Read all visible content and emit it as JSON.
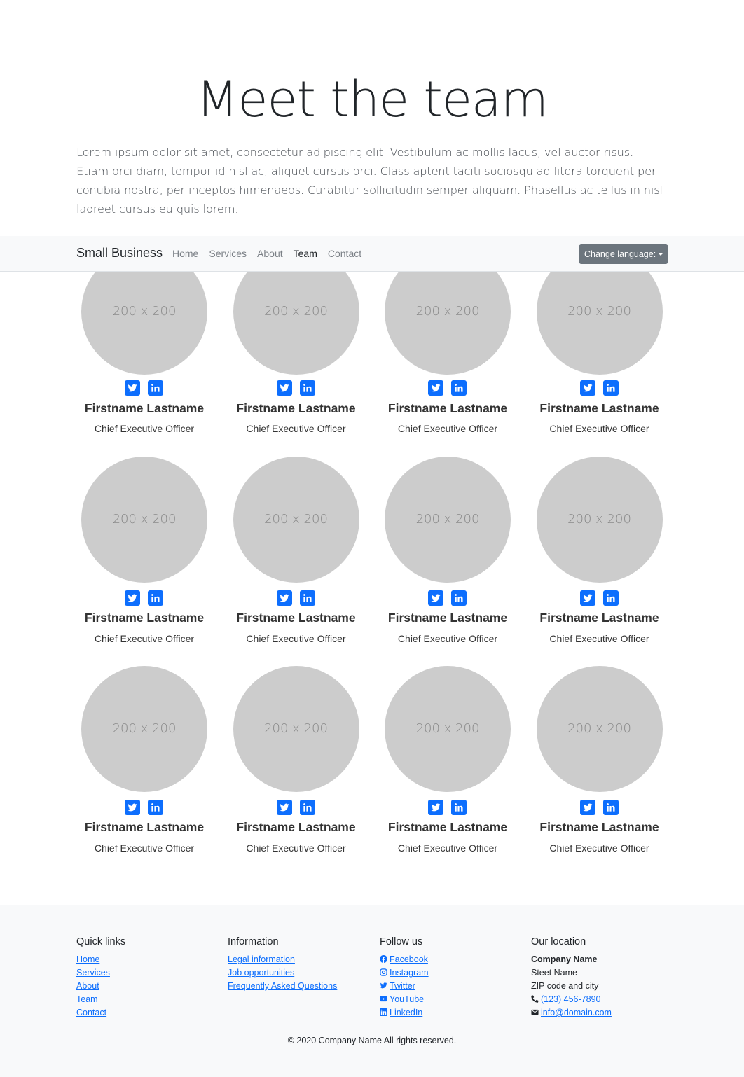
{
  "hero": {
    "title": "Meet the team",
    "intro": "Lorem ipsum dolor sit amet, consectetur adipiscing elit. Vestibulum ac mollis lacus, vel auctor risus. Etiam orci diam, tempor id nisl ac, aliquet cursus orci. Class aptent taciti sociosqu ad litora torquent per conubia nostra, per inceptos himenaeos. Curabitur sollicitudin semper aliquam. Phasellus ac tellus in nisl laoreet cursus eu quis lorem."
  },
  "navbar": {
    "brand": "Small Business",
    "links": [
      "Home",
      "Services",
      "About",
      "Team",
      "Contact"
    ],
    "active": "Team",
    "language_button": "Change language:"
  },
  "team": {
    "photo_placeholder": "200 x 200",
    "members": [
      {
        "name": "Firstname Lastname",
        "title": "Chief Executive Officer"
      },
      {
        "name": "Firstname Lastname",
        "title": "Chief Executive Officer"
      },
      {
        "name": "Firstname Lastname",
        "title": "Chief Executive Officer"
      },
      {
        "name": "Firstname Lastname",
        "title": "Chief Executive Officer"
      },
      {
        "name": "Firstname Lastname",
        "title": "Chief Executive Officer"
      },
      {
        "name": "Firstname Lastname",
        "title": "Chief Executive Officer"
      },
      {
        "name": "Firstname Lastname",
        "title": "Chief Executive Officer"
      },
      {
        "name": "Firstname Lastname",
        "title": "Chief Executive Officer"
      },
      {
        "name": "Firstname Lastname",
        "title": "Chief Executive Officer"
      },
      {
        "name": "Firstname Lastname",
        "title": "Chief Executive Officer"
      },
      {
        "name": "Firstname Lastname",
        "title": "Chief Executive Officer"
      },
      {
        "name": "Firstname Lastname",
        "title": "Chief Executive Officer"
      }
    ],
    "social_icons": [
      "twitter-icon",
      "linkedin-icon"
    ]
  },
  "footer": {
    "quick_links": {
      "heading": "Quick links",
      "items": [
        "Home",
        "Services",
        "About",
        "Team",
        "Contact"
      ]
    },
    "information": {
      "heading": "Information",
      "items": [
        "Legal information",
        "Job opportunities",
        "Frequently Asked Questions"
      ]
    },
    "follow_us": {
      "heading": "Follow us",
      "items": [
        {
          "label": "Facebook",
          "icon": "facebook-icon"
        },
        {
          "label": "Instagram",
          "icon": "instagram-icon"
        },
        {
          "label": "Twitter",
          "icon": "twitter-icon"
        },
        {
          "label": "YouTube",
          "icon": "youtube-icon"
        },
        {
          "label": "LinkedIn",
          "icon": "linkedin-icon"
        }
      ]
    },
    "location": {
      "heading": "Our location",
      "company": "Company Name",
      "street": "Steet Name",
      "zip_city": "ZIP code and city",
      "phone": "(123) 456-7890",
      "email": "info@domain.com"
    },
    "copyright": "© 2020 Company Name   All rights reserved."
  },
  "colors": {
    "accent": "#0d6efd",
    "navbar_bg": "#f8f9fa",
    "button_bg": "#6c757d",
    "placeholder_bg": "#cccccc"
  }
}
